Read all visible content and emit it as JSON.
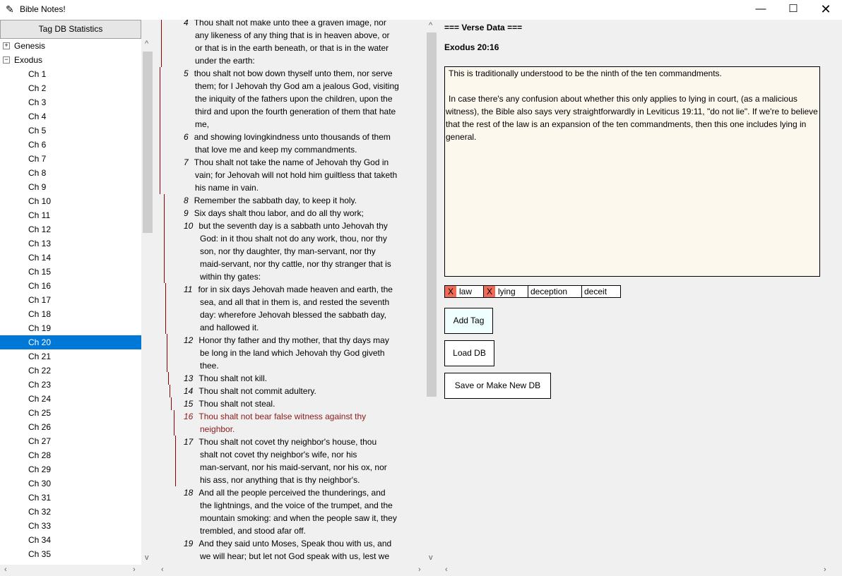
{
  "window": {
    "title": "Bible Notes!",
    "app_icon": "feather-icon",
    "minimize": "—",
    "maximize": "☐",
    "close": "✕"
  },
  "tree": {
    "header": "Tag DB Statistics",
    "books": [
      {
        "label": "Genesis",
        "expander": "+"
      },
      {
        "label": "Exodus",
        "expander": "−"
      }
    ],
    "chapters": [
      "Ch 1",
      "Ch 2",
      "Ch 3",
      "Ch 4",
      "Ch 5",
      "Ch 6",
      "Ch 7",
      "Ch 8",
      "Ch 9",
      "Ch 10",
      "Ch 11",
      "Ch 12",
      "Ch 13",
      "Ch 14",
      "Ch 15",
      "Ch 16",
      "Ch 17",
      "Ch 18",
      "Ch 19",
      "Ch 20",
      "Ch 21",
      "Ch 22",
      "Ch 23",
      "Ch 24",
      "Ch 25",
      "Ch 26",
      "Ch 27",
      "Ch 28",
      "Ch 29",
      "Ch 30",
      "Ch 31",
      "Ch 32",
      "Ch 33",
      "Ch 34",
      "Ch 35"
    ],
    "selected": "Ch 20"
  },
  "verses": [
    {
      "num": "4",
      "lines": [
        "Thou shalt not make unto thee a graven image, nor",
        "any likeness of any thing that is in heaven above, or",
        "or that is in the earth beneath, or that is in the water",
        "under the earth:"
      ]
    },
    {
      "num": "5",
      "lines": [
        "thou shalt not bow down thyself unto them, nor serve",
        "them; for I Jehovah thy God am a jealous God, visiting",
        "the iniquity of the fathers upon the children, upon the",
        "third and upon the fourth generation of them that hate",
        "me,"
      ]
    },
    {
      "num": "6",
      "lines": [
        "and showing lovingkindness unto thousands of them",
        "that love me and keep my commandments."
      ]
    },
    {
      "num": "7",
      "lines": [
        "Thou shalt not take the name of Jehovah thy God in",
        "vain; for Jehovah will not hold him guiltless that taketh",
        "his name in vain."
      ]
    },
    {
      "num": "8",
      "lines": [
        "Remember the sabbath day, to keep it holy."
      ]
    },
    {
      "num": "9",
      "lines": [
        "Six days shalt thou labor, and do all thy work;"
      ]
    },
    {
      "num": "10",
      "lines": [
        "but the seventh day is a sabbath unto Jehovah thy",
        "God: in it thou shalt not do any work, thou, nor thy",
        "son, nor thy daughter, thy man-servant, nor thy",
        "maid-servant, nor thy cattle, nor thy stranger that is",
        "within thy gates:"
      ]
    },
    {
      "num": "11",
      "lines": [
        "for in six days Jehovah made heaven and earth, the",
        "sea, and all that in them is, and rested the seventh",
        "day: wherefore Jehovah blessed the sabbath day,",
        "and hallowed it."
      ]
    },
    {
      "num": "12",
      "lines": [
        "Honor thy father and thy mother, that thy days may",
        "be long in the land which Jehovah thy God giveth",
        "thee."
      ]
    },
    {
      "num": "13",
      "lines": [
        "Thou shalt not kill."
      ]
    },
    {
      "num": "14",
      "lines": [
        "Thou shalt not commit adultery."
      ]
    },
    {
      "num": "15",
      "lines": [
        "Thou shalt not steal."
      ]
    },
    {
      "num": "16",
      "lines": [
        "Thou shalt not bear false witness against thy",
        "neighbor."
      ],
      "highlight": true
    },
    {
      "num": "17",
      "lines": [
        "Thou shalt not covet thy neighbor's house, thou",
        "shalt not covet thy neighbor's wife, nor his",
        "man-servant, nor his maid-servant, nor his ox, nor",
        "his ass, nor anything that is thy neighbor's."
      ]
    },
    {
      "num": "18",
      "lines": [
        "And all the people perceived the thunderings, and",
        "the lightnings, and the voice of the trumpet, and the",
        "mountain smoking: and when the people saw it, they",
        "trembled, and stood afar off."
      ]
    },
    {
      "num": "19",
      "lines": [
        "And they said unto Moses, Speak thou with us, and",
        "we will hear; but let not God speak with us, lest we"
      ]
    }
  ],
  "verse_data": {
    "header": "=== Verse Data ===",
    "reference": "Exodus 20:16",
    "note_paragraphs": [
      "This is traditionally understood to be the ninth of the ten commandments.",
      "",
      "In case there's any confusion about whether this only applies to lying in court, (as a malicious witness), the Bible also says very straightforwardly in Leviticus 19:11, \"do not lie\". If we're to believe that the rest of the law is an expansion of the ten commandments, then this one includes lying in general."
    ],
    "tags": [
      {
        "remove": "X",
        "label": "law"
      },
      {
        "remove": "X",
        "label": "lying"
      },
      {
        "label": "deception"
      },
      {
        "label": "deceit"
      }
    ],
    "buttons": {
      "add_tag": "Add Tag",
      "load_db": "Load DB",
      "save_db": "Save or Make New DB"
    }
  },
  "colors": {
    "selected": "#0078d7",
    "highlight_text": "#8b1a1a",
    "note_bg": "#fdf8ed",
    "tag_remove": "#ef6b57"
  }
}
